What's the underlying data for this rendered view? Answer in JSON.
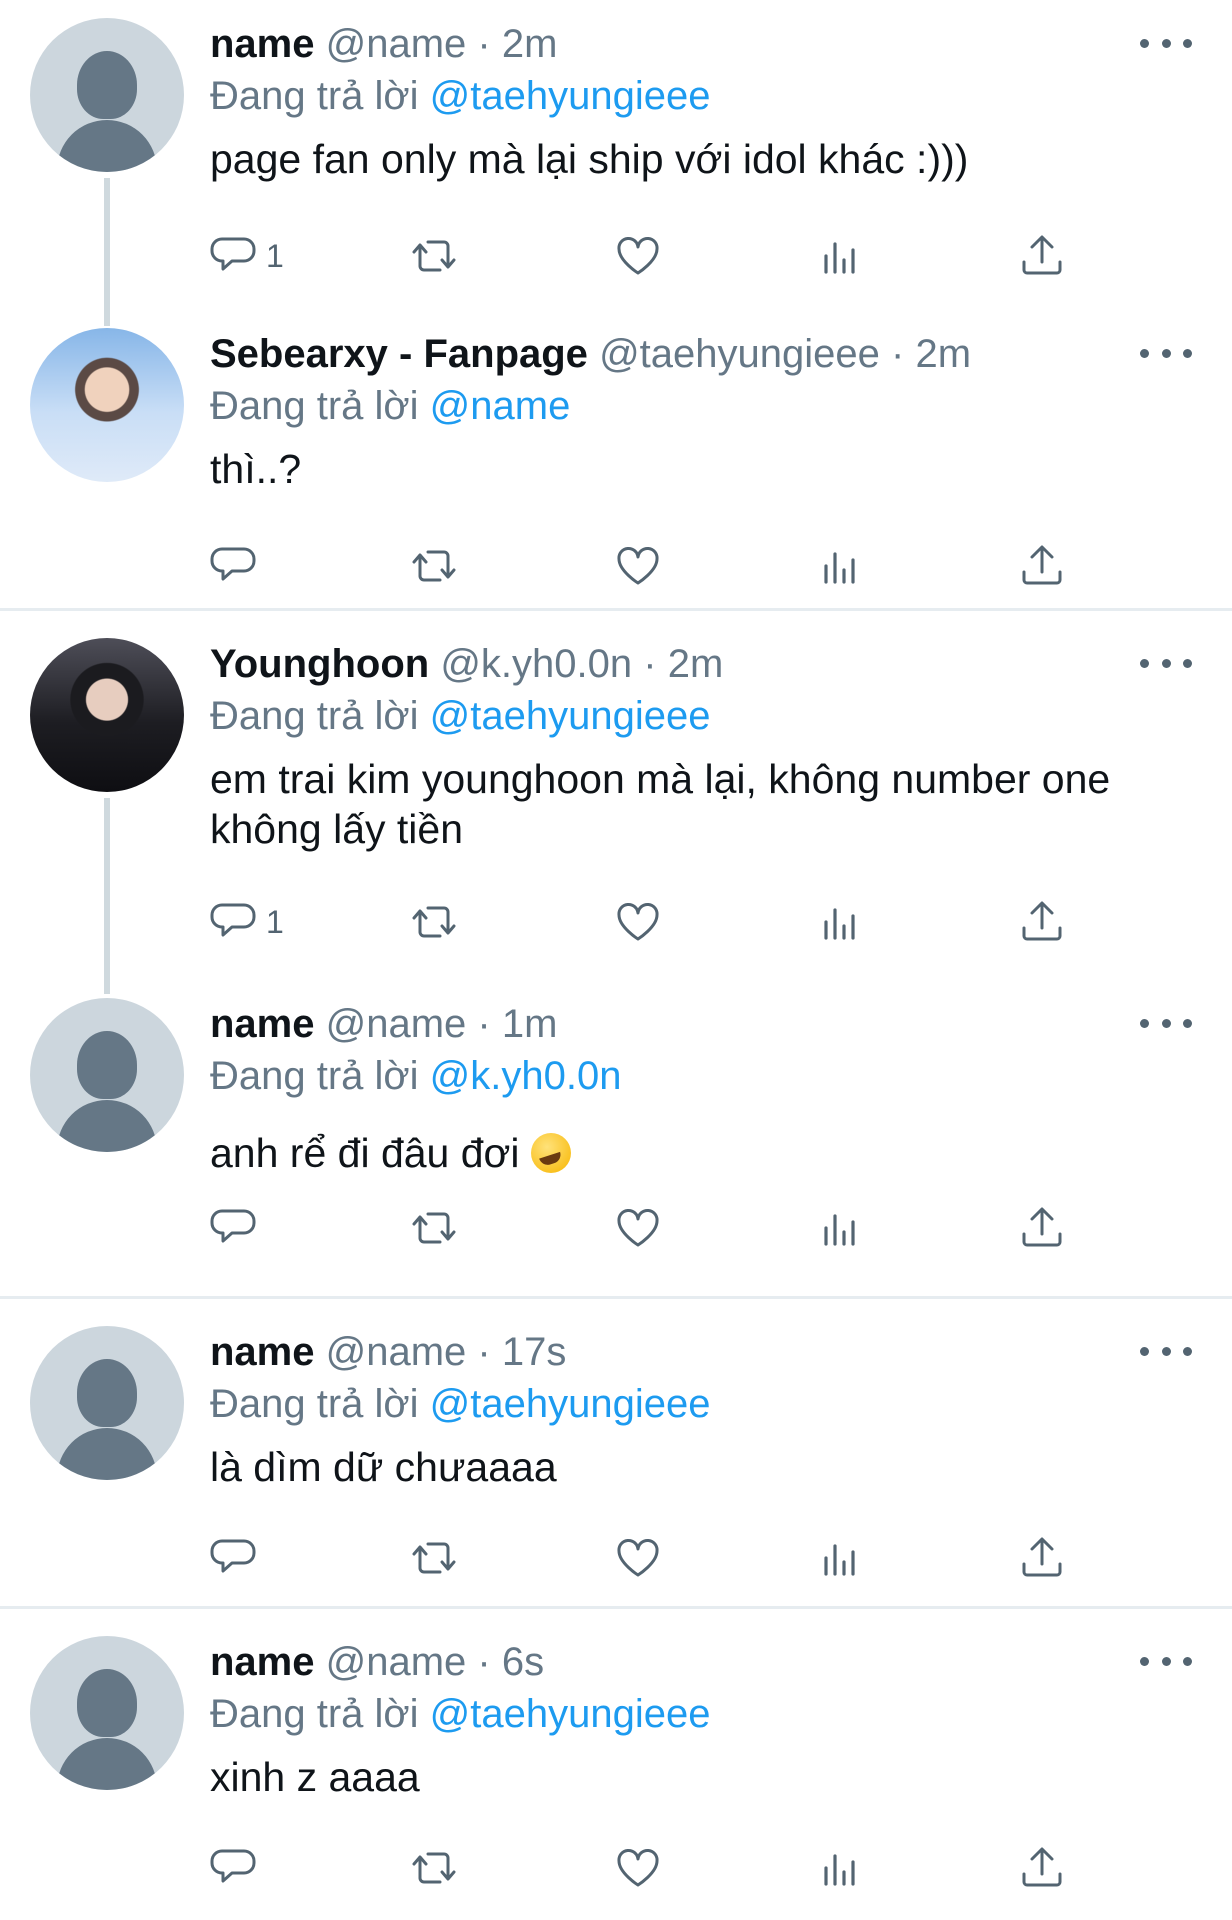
{
  "tweets": [
    {
      "name": "name",
      "handle": "@name",
      "time": "2m",
      "reply_prefix": "Đang trả lời",
      "reply_to": "@taehyungieee",
      "text": "page fan only mà lại ship với idol khác :)))",
      "reply_count": "1",
      "avatar": "placeholder"
    },
    {
      "name": "Sebearxy - Fanpage",
      "handle": "@taehyungieee",
      "time": "2m",
      "reply_prefix": "Đang trả lời",
      "reply_to": "@name",
      "text": "thì..?",
      "reply_count": "",
      "avatar": "photo"
    },
    {
      "name": "Younghoon",
      "handle": "@k.yh0.0n",
      "time": "2m",
      "reply_prefix": "Đang trả lời",
      "reply_to": "@taehyungieee",
      "text": "em trai kim younghoon mà lại, không number one không lấy tiền",
      "reply_count": "1",
      "avatar": "photo"
    },
    {
      "name": "name",
      "handle": "@name",
      "time": "1m",
      "reply_prefix": "Đang trả lời",
      "reply_to": "@k.yh0.0n",
      "text": "anh rể đi đâu đơi",
      "reply_count": "",
      "avatar": "placeholder",
      "emoji": "rolling-on-floor-laughing-emoji"
    },
    {
      "name": "name",
      "handle": "@name",
      "time": "17s",
      "reply_prefix": "Đang trả lời",
      "reply_to": "@taehyungieee",
      "text": "là dìm dữ chưaaaa",
      "reply_count": "",
      "avatar": "placeholder"
    },
    {
      "name": "name",
      "handle": "@name",
      "time": "6s",
      "reply_prefix": "Đang trả lời",
      "reply_to": "@taehyungieee",
      "text": "xinh z aaaa",
      "reply_count": "",
      "avatar": "placeholder"
    }
  ],
  "separator": "·",
  "icons": {
    "reply": "reply-icon",
    "retweet": "retweet-icon",
    "like": "like-icon",
    "analytics": "analytics-icon",
    "share": "share-icon",
    "more": "more-icon"
  },
  "colors": {
    "accent": "#1d9bf0",
    "muted": "#657786",
    "text": "#0f1419"
  }
}
